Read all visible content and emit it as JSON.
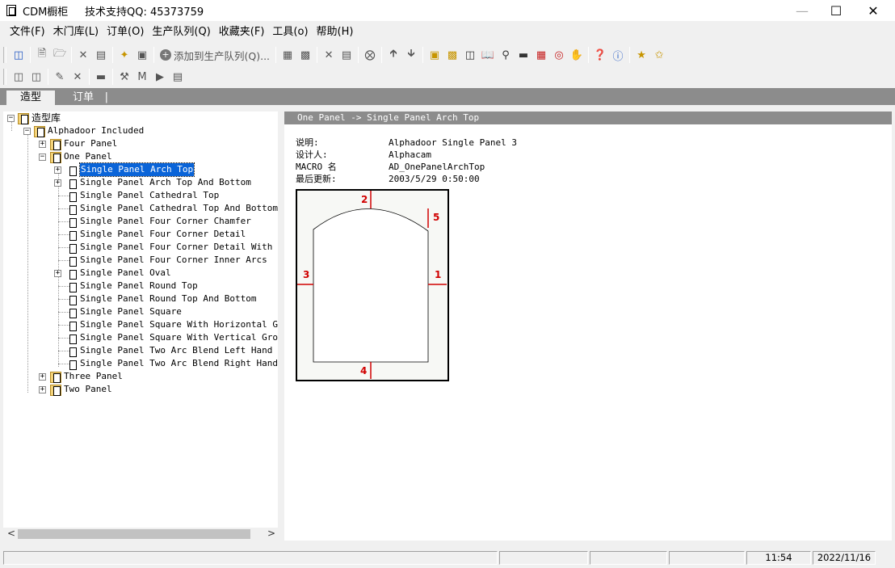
{
  "window": {
    "title": "CDM橱柜",
    "support": "技术支持QQ:  45373759",
    "minimize": "—",
    "maximize": "☐",
    "close": "✕"
  },
  "menu": [
    "文件(F)",
    "木门库(L)",
    "订单(O)",
    "生产队列(Q)",
    "收藏夹(F)",
    "工具(o)",
    "帮助(H)"
  ],
  "toolbar": {
    "add_to_queue": "添加到生产队列(Q)..."
  },
  "tabs": {
    "active": "造型",
    "inactive": "订单"
  },
  "tree": {
    "root": "造型库",
    "library": "Alphadoor Included",
    "groups": [
      "Four Panel",
      "One Panel",
      "Three Panel",
      "Two Panel"
    ],
    "one_panel_items": [
      "Single Panel Arch Top",
      "Single Panel Arch Top And Bottom",
      "Single Panel Cathedral Top",
      "Single Panel Cathedral Top And Bottom",
      "Single Panel Four Corner Chamfer",
      "Single Panel Four Corner Detail",
      "Single Panel Four Corner Detail With Rad",
      "Single Panel Four Corner Inner Arcs",
      "Single Panel Oval",
      "Single Panel Round Top",
      "Single Panel Round Top And Bottom",
      "Single Panel Square",
      "Single Panel Square With Horizontal Groo",
      "Single Panel Square With Vertical Groove",
      "Single Panel Two Arc Blend Left Hand",
      "Single Panel Two Arc Blend Right Hand"
    ],
    "selected": "Single Panel Arch Top"
  },
  "detail": {
    "breadcrumb": "One Panel -> Single Panel Arch Top",
    "props": [
      {
        "key": "说明:",
        "value": "Alphadoor Single Panel 3"
      },
      {
        "key": "设计人:",
        "value": "Alphacam"
      },
      {
        "key": "MACRO 名",
        "value": "AD_OnePanelArchTop"
      },
      {
        "key": "最后更新:",
        "value": "2003/5/29 0:50:00"
      }
    ],
    "preview_labels": [
      "1",
      "2",
      "3",
      "4",
      "5"
    ]
  },
  "statusbar": {
    "time": "11:54",
    "date": "2022/11/16"
  },
  "colors": {
    "tab_strip": "#8c8c8c",
    "selection": "#0a64d8",
    "dimension": "#d00000"
  }
}
